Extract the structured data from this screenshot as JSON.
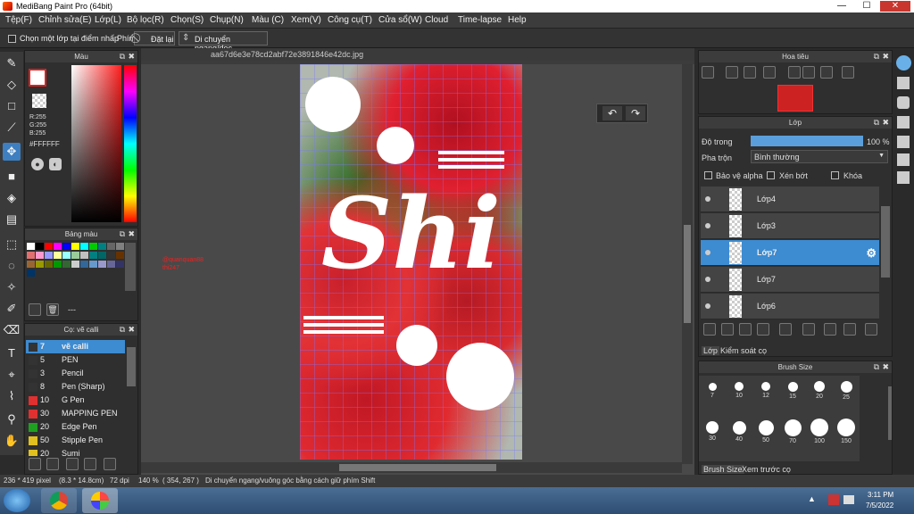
{
  "window": {
    "title": "MediBang Paint Pro (64bit)",
    "minimize": "—",
    "maximize": "☐",
    "close": "✕"
  },
  "menu": [
    "Tệp(F)",
    "Chỉnh sửa(E)",
    "Lớp(L)",
    "Bộ lọc(R)",
    "Chọn(S)",
    "Chụp(N)",
    "Màu (C)",
    "Xem(V)",
    "Công cụ(T)",
    "Cửa sổ(W)",
    "Cloud",
    "Time-lapse",
    "Help"
  ],
  "options": {
    "select_layer_label": "Chọn một lớp tại điểm nhấp",
    "key_label": "Phím",
    "reset_label": "Đặt lại",
    "move_label": "Di chuyển ngang/dọc"
  },
  "color_panel": {
    "title": "Màu",
    "r": "R:255",
    "g": "G:255",
    "b": "B:255",
    "hex": "#FFFFFF",
    "primary_color": "#ffffff",
    "secondary_color": "#e02020"
  },
  "palette_panel": {
    "title": "Bảng màu",
    "colors": [
      "#ffffff",
      "#000000",
      "#ff0000",
      "#ff00ff",
      "#0000ff",
      "#ffff00",
      "#00ffff",
      "#00cc00",
      "#008080",
      "#666666",
      "#808080",
      "#e07070",
      "#ff99cc",
      "#9999ff",
      "#ffff99",
      "#99ffff",
      "#99cc99",
      "#c0c0c0",
      "#008080",
      "#006666",
      "#333333",
      "#663300",
      "#996633",
      "#999900",
      "#666600",
      "#009900",
      "#336633",
      "#cccccc",
      "#336699",
      "#6699cc",
      "#9999cc",
      "#666699",
      "#333366",
      "#003366"
    ],
    "more_label": "---"
  },
  "brush_panel": {
    "title": "Cọ: vẽ calli",
    "brushes": [
      {
        "size": "7",
        "name": "vẽ calli",
        "color": "#333333",
        "selected": true
      },
      {
        "size": "5",
        "name": "PEN",
        "color": "#333333"
      },
      {
        "size": "3",
        "name": "Pencil",
        "color": "#333333"
      },
      {
        "size": "8",
        "name": "Pen (Sharp)",
        "color": "#333333"
      },
      {
        "size": "10",
        "name": "G Pen",
        "color": "#e03030"
      },
      {
        "size": "30",
        "name": "MAPPING PEN",
        "color": "#e03030"
      },
      {
        "size": "20",
        "name": "Edge Pen",
        "color": "#20a020"
      },
      {
        "size": "50",
        "name": "Stipple Pen",
        "color": "#e0c020"
      },
      {
        "size": "20",
        "name": "Sumi",
        "color": "#e0c020"
      }
    ]
  },
  "document": {
    "tab": "aa67d6e3e78cd2abf72e3891846e42dc.jpg",
    "watermark_1": "@quanquan88",
    "watermark_2": "thi247",
    "art_text": "Shi"
  },
  "navigator": {
    "title": "Hoa tiêu"
  },
  "layers": {
    "title": "Lớp",
    "opacity_label": "Độ trong",
    "opacity_value": "100 %",
    "opacity": 1.0,
    "blend_label": "Pha trộn",
    "blend_value": "Bình thường",
    "protect_alpha": "Bảo vệ alpha",
    "clipping": "Xén bớt",
    "lock": "Khóa",
    "items": [
      "Lớp4",
      "Lớp3",
      "Lớp7",
      "Lớp7",
      "Lớp6"
    ],
    "tab_layer": "Lớp",
    "tab_control": "Kiểm soát cọ"
  },
  "brush_size": {
    "title": "Brush Size",
    "sizes": [
      "7",
      "10",
      "12",
      "15",
      "20",
      "25",
      "30",
      "40",
      "50",
      "70",
      "100",
      "150"
    ],
    "tab_size": "Brush Size",
    "tab_preview": "Xem trước cọ"
  },
  "status": {
    "dims": "236 * 419 pixel",
    "cm": "(8.3 * 14.8cm)",
    "dpi": "72 dpi",
    "zoom": "140 %",
    "coords": "( 354, 267 )",
    "hint": "Di chuyển ngang/vuông góc bằng cách giữ phím Shift"
  },
  "taskbar": {
    "time": "3:11 PM",
    "date": "7/5/2022"
  }
}
